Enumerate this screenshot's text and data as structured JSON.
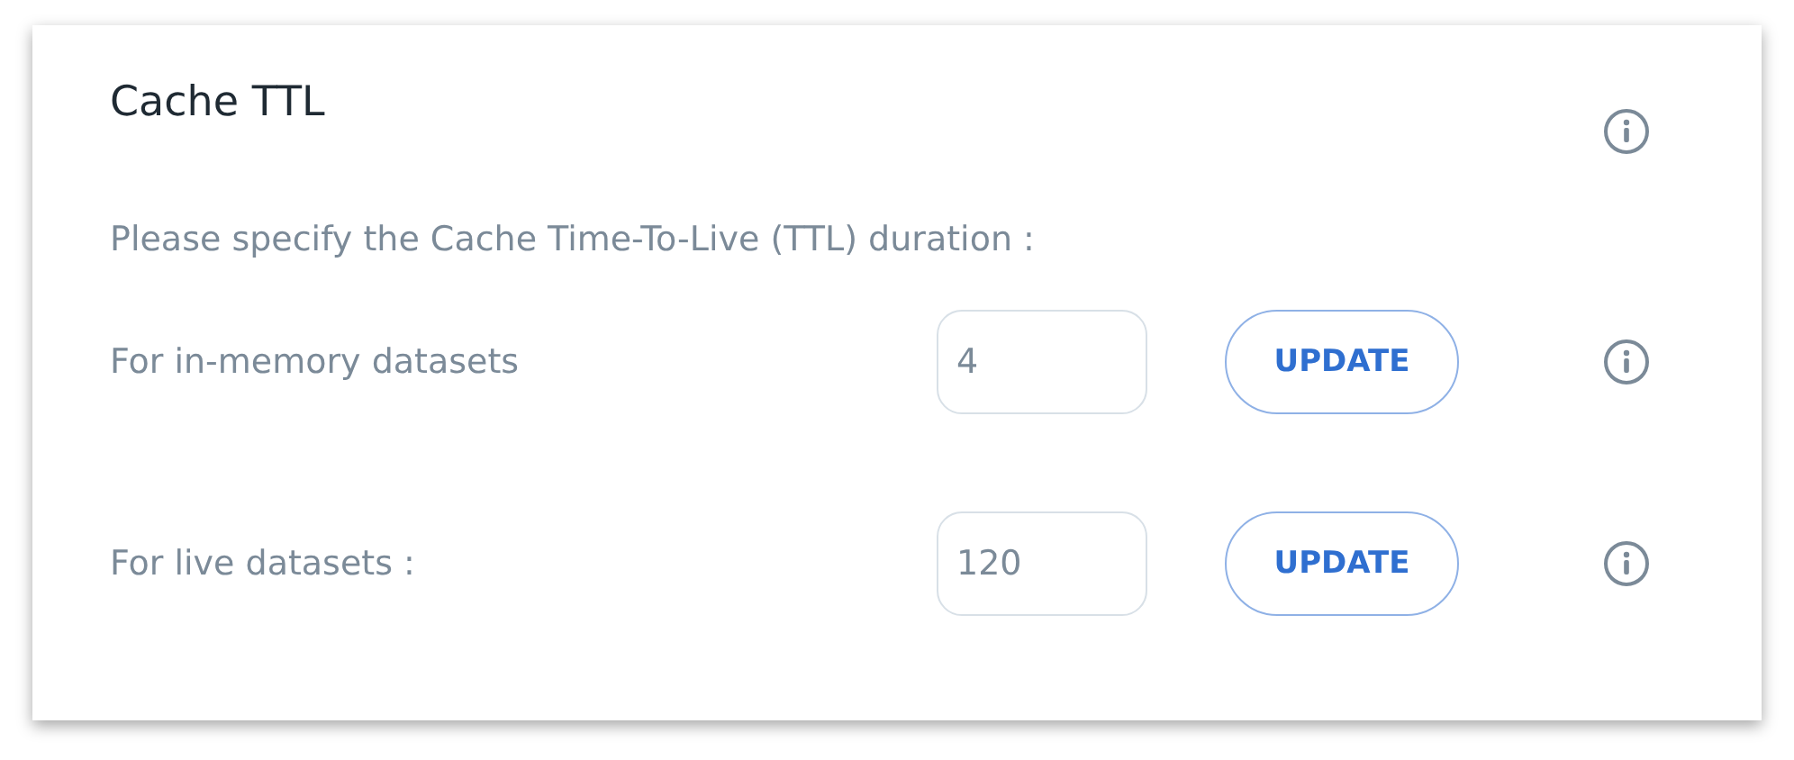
{
  "panel": {
    "title": "Cache TTL",
    "description": "Please specify the Cache Time-To-Live (TTL) duration :",
    "settings": [
      {
        "label": "For in-memory datasets",
        "value": "4",
        "button": "UPDATE"
      },
      {
        "label": "For live datasets :",
        "value": "120",
        "button": "UPDATE"
      }
    ]
  }
}
